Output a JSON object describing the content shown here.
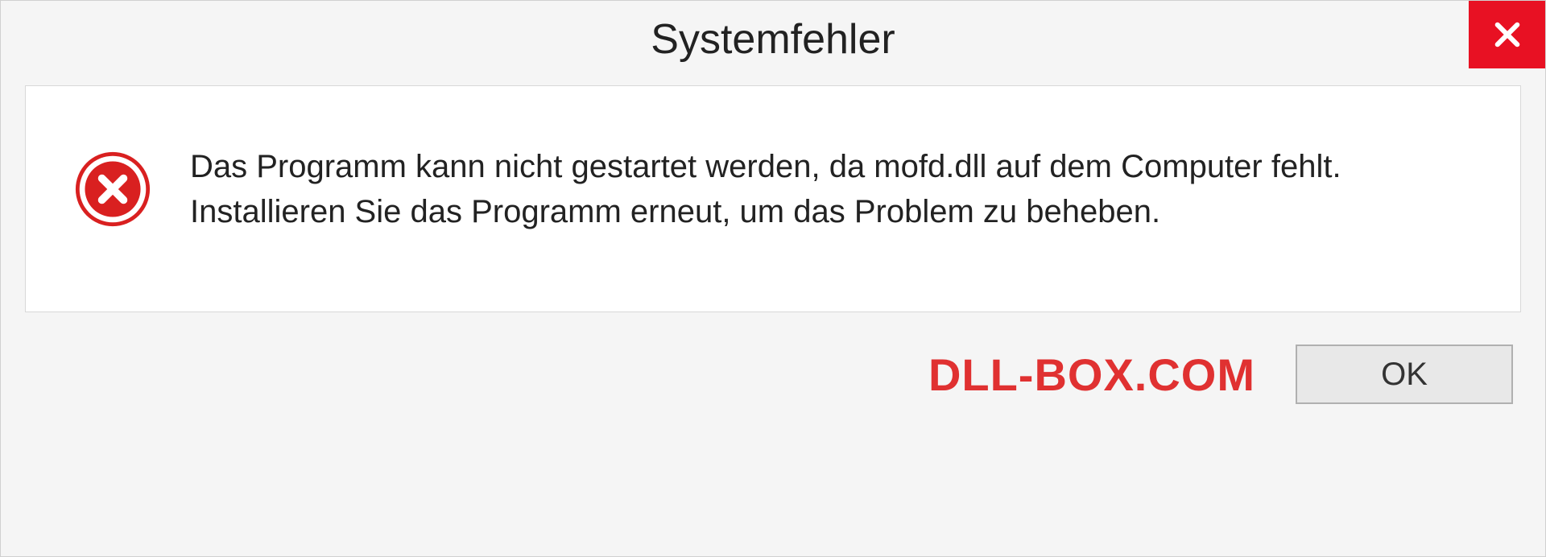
{
  "dialog": {
    "title": "Systemfehler",
    "message": "Das Programm kann nicht gestartet werden, da mofd.dll auf dem Computer fehlt. Installieren Sie das Programm erneut, um das Problem zu beheben.",
    "watermark": "DLL-BOX.COM",
    "ok_label": "OK"
  }
}
